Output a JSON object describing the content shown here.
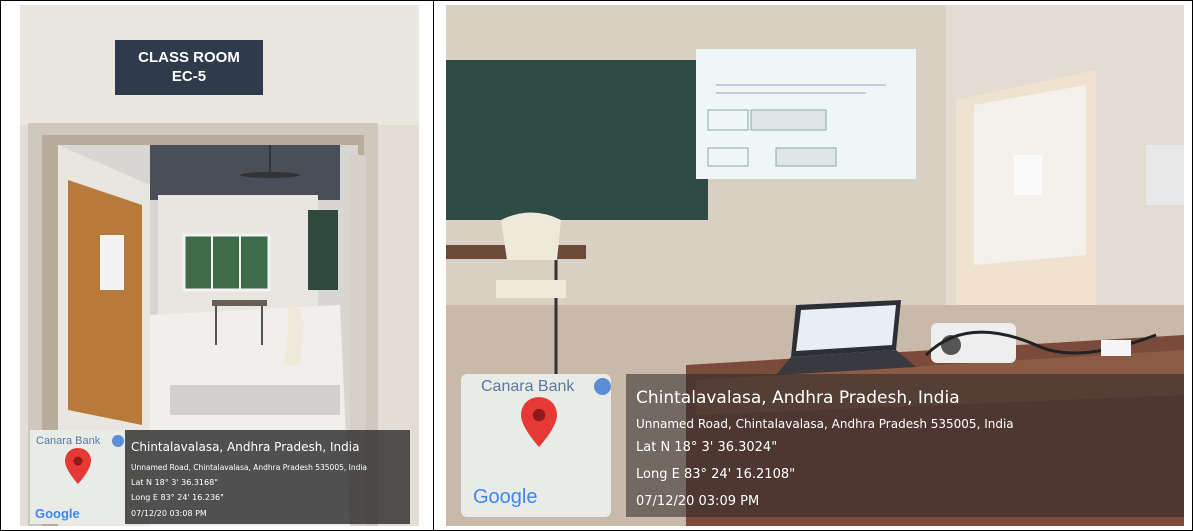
{
  "left_photo": {
    "sign_line1": "CLASS ROOM",
    "sign_line2": "EC-5",
    "map_place": "Canara Bank",
    "map_brand": "Google",
    "location_title": "Chintalavalasa, Andhra Pradesh, India",
    "address": "Unnamed Road, Chintalavalasa, Andhra Pradesh 535005, India",
    "lat": "Lat N 18° 3' 36.3168\"",
    "long": "Long E 83° 24' 16.236\"",
    "timestamp": "07/12/20 03:08 PM"
  },
  "right_photo": {
    "map_place": "Canara Bank",
    "map_brand": "Google",
    "location_title": "Chintalavalasa, Andhra Pradesh, India",
    "address": "Unnamed Road, Chintalavalasa, Andhra Pradesh 535005, India",
    "lat": "Lat N 18° 3' 36.3024\"",
    "long": "Long E 83° 24' 16.2108\"",
    "timestamp": "07/12/20 03:09 PM"
  },
  "colors": {
    "pin_red": "#e53935",
    "stamp_bg": "#2d2d2d",
    "google_blue": "#4285f4",
    "google_red": "#ea4335",
    "google_yellow": "#fbbc05",
    "google_green": "#34a853"
  }
}
